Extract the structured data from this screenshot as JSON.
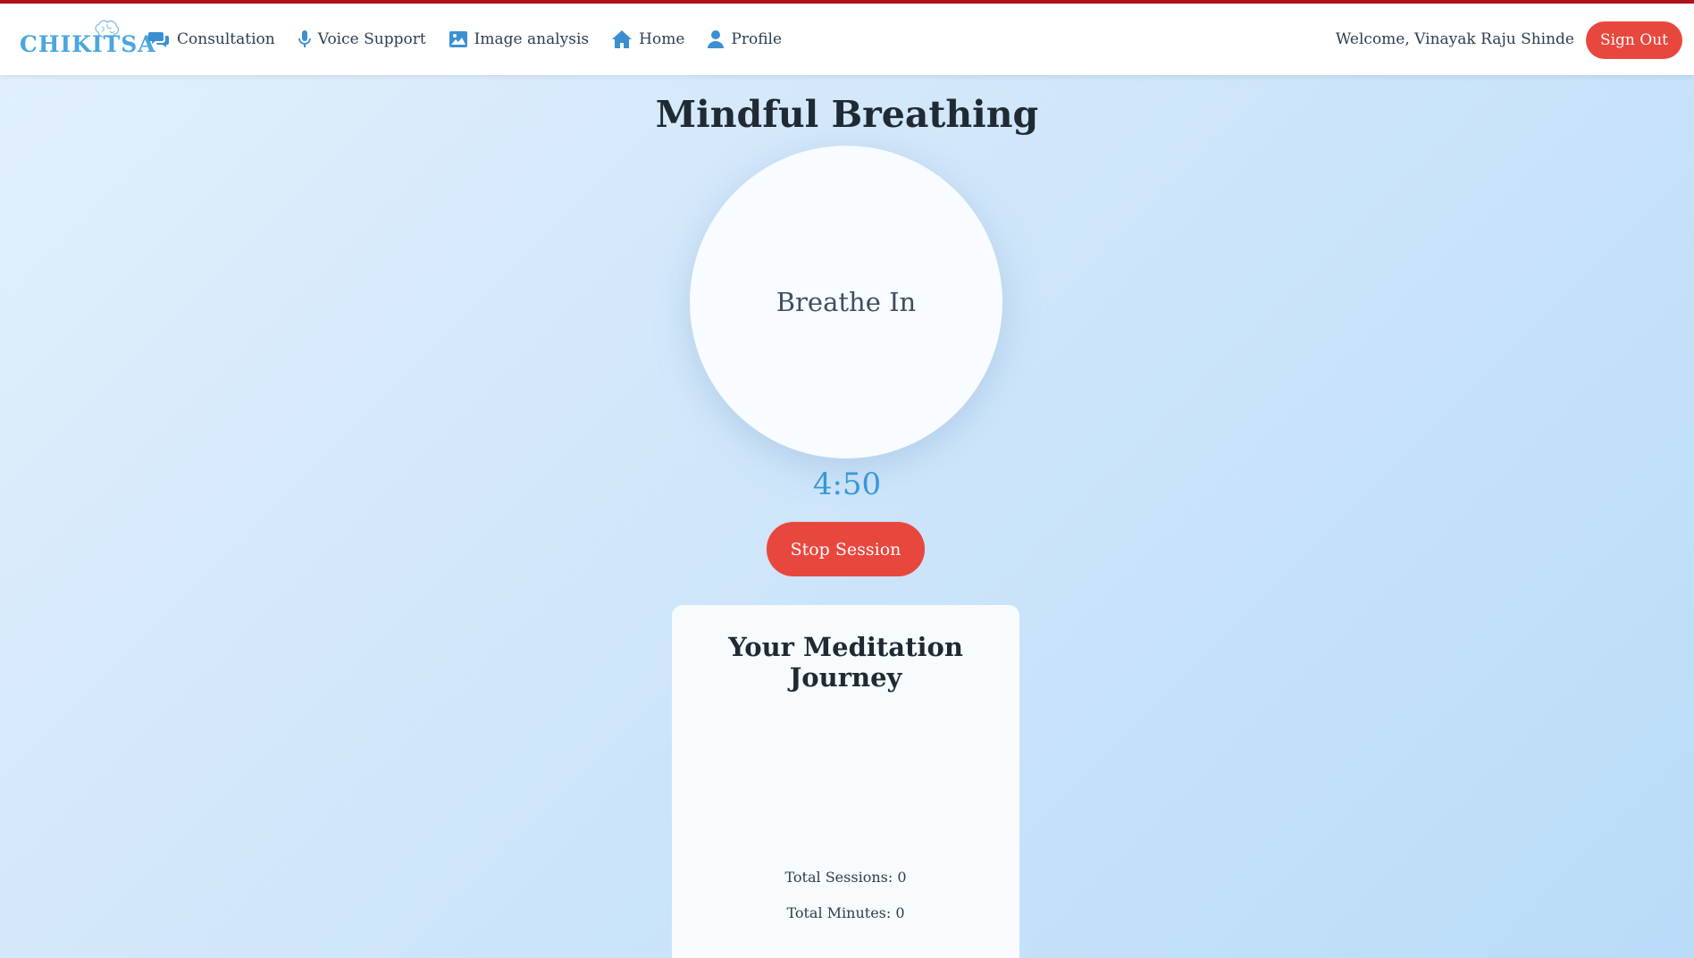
{
  "brand": {
    "logo_text": "CHIKITSA"
  },
  "nav": {
    "items": [
      {
        "label": "Consultation",
        "icon": "chat-bubbles-icon"
      },
      {
        "label": "Voice Support",
        "icon": "microphone-icon"
      },
      {
        "label": "Image analysis",
        "icon": "image-icon"
      },
      {
        "label": "Home",
        "icon": "home-icon"
      },
      {
        "label": "Profile",
        "icon": "user-icon"
      }
    ],
    "welcome": "Welcome, Vinayak Raju Shinde",
    "signout_label": "Sign Out"
  },
  "main": {
    "title": "Mindful Breathing",
    "breath_instruction": "Breathe In",
    "timer": "4:50",
    "stop_label": "Stop Session"
  },
  "journey": {
    "title": "Your Meditation Journey",
    "total_sessions": "Total Sessions: 0",
    "total_minutes": "Total Minutes: 0"
  },
  "colors": {
    "accent_blue": "#3798d8",
    "danger_red": "#e8473d",
    "top_strip": "#b0121e"
  }
}
